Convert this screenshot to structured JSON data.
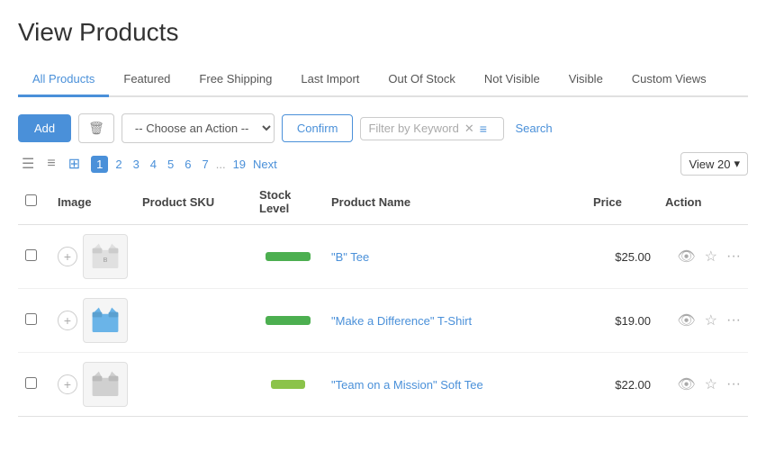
{
  "page": {
    "title": "View Products"
  },
  "tabs": [
    {
      "label": "All Products",
      "active": true
    },
    {
      "label": "Featured",
      "active": false
    },
    {
      "label": "Free Shipping",
      "active": false
    },
    {
      "label": "Last Import",
      "active": false
    },
    {
      "label": "Out Of Stock",
      "active": false
    },
    {
      "label": "Not Visible",
      "active": false
    },
    {
      "label": "Visible",
      "active": false
    },
    {
      "label": "Custom Views",
      "active": false
    }
  ],
  "toolbar": {
    "add_label": "Add",
    "confirm_label": "Confirm",
    "action_placeholder": "-- Choose an Action --",
    "filter_placeholder": "Filter by Keyword",
    "search_label": "Search"
  },
  "pagination": {
    "pages": [
      "1",
      "2",
      "3",
      "4",
      "5",
      "6",
      "7",
      "...",
      "19"
    ],
    "next_label": "Next",
    "view_label": "View 20"
  },
  "table": {
    "headers": [
      "",
      "Image",
      "Product SKU",
      "Stock Level",
      "Product Name",
      "Price",
      "Action"
    ],
    "rows": [
      {
        "sku": "",
        "name": "\"B\" Tee",
        "price": "$25.00",
        "stock": "full"
      },
      {
        "sku": "",
        "name": "\"Make a Difference\" T-Shirt",
        "price": "$19.00",
        "stock": "full"
      },
      {
        "sku": "",
        "name": "\"Team on a Mission\" Soft Tee",
        "price": "$22.00",
        "stock": "medium"
      }
    ]
  }
}
